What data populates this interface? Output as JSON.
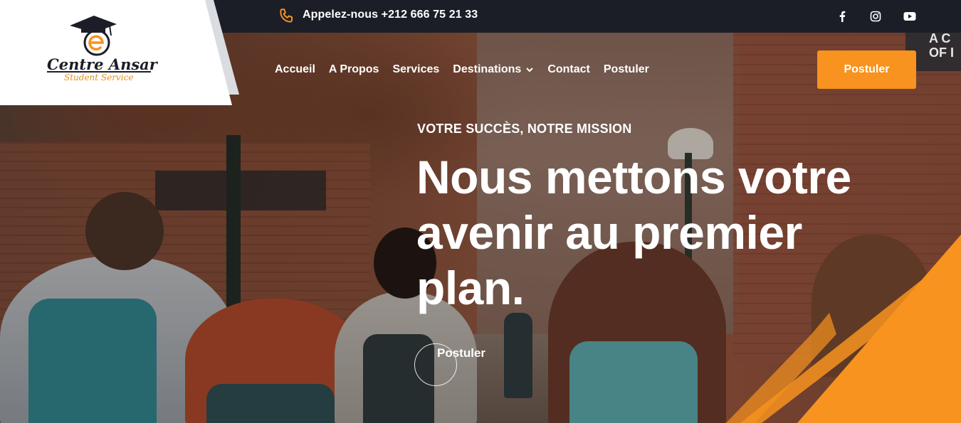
{
  "topbar": {
    "phone_icon": "phone-icon",
    "phone_text": "Appelez-nous +212 666 75 21 33",
    "social": [
      {
        "name": "facebook",
        "icon": "facebook-icon"
      },
      {
        "name": "instagram",
        "icon": "instagram-icon"
      },
      {
        "name": "youtube",
        "icon": "youtube-icon"
      }
    ]
  },
  "logo": {
    "title": "Centre Ansar",
    "subtitle": "Student Service",
    "icon": "graduation-cap-logo-icon"
  },
  "nav": {
    "items": [
      {
        "label": "Accueil"
      },
      {
        "label": "A Propos"
      },
      {
        "label": "Services"
      },
      {
        "label": "Destinations",
        "dropdown": true
      },
      {
        "label": "Contact"
      },
      {
        "label": "Postuler"
      }
    ],
    "cta_label": "Postuler"
  },
  "hero": {
    "tagline": "VOTRE SUCCÈS, NOTRE MISSION",
    "headline": "Nous mettons votre avenir au premier plan.",
    "button_label": "Postuler",
    "corner_text": "A C\nOF I"
  },
  "colors": {
    "accent": "#f7931e",
    "topbar": "#1c1e27",
    "white": "#ffffff"
  }
}
